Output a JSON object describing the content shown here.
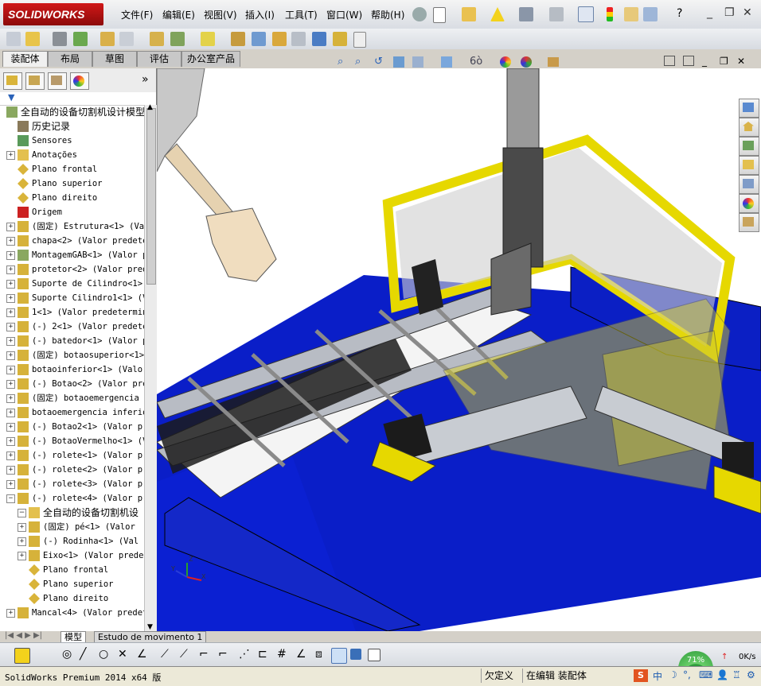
{
  "app": {
    "logo_text": "SOLIDWORKS",
    "brand_color": "#c41212"
  },
  "menu": {
    "items": [
      "文件(F)",
      "编辑(E)",
      "视图(V)",
      "插入(I)",
      "工具(T)",
      "窗口(W)",
      "帮助(H)"
    ]
  },
  "command_tabs": [
    "装配体",
    "布局",
    "草图",
    "评估",
    "办公室产品"
  ],
  "active_command_tab": "装配体",
  "feature_tree": {
    "root": "全自动的设备切割机设计模型",
    "items": [
      {
        "label": "历史记录",
        "icon": "history-icon"
      },
      {
        "label": "Sensores",
        "icon": "sensor-icon"
      },
      {
        "label": "Anotações",
        "icon": "annotation-icon"
      },
      {
        "label": "Plano frontal",
        "icon": "plane-icon"
      },
      {
        "label": "Plano superior",
        "icon": "plane-icon"
      },
      {
        "label": "Plano direito",
        "icon": "plane-icon"
      },
      {
        "label": "Origem",
        "icon": "origin-icon"
      },
      {
        "label": "(固定) Estrutura<1> (Va",
        "icon": "part-icon"
      },
      {
        "label": "chapa<2> (Valor predete",
        "icon": "part-icon"
      },
      {
        "label": "MontagemGAB<1> (Valor p",
        "icon": "assembly-icon"
      },
      {
        "label": "protetor<2> (Valor pred",
        "icon": "part-icon"
      },
      {
        "label": "Suporte de Cilindro<1>",
        "icon": "part-icon"
      },
      {
        "label": "Suporte Cilindro1<1> (V",
        "icon": "part-icon"
      },
      {
        "label": "1<1> (Valor predetermin",
        "icon": "part-icon"
      },
      {
        "label": "(-) 2<1> (Valor predete",
        "icon": "part-icon"
      },
      {
        "label": "(-) batedor<1> (Valor p",
        "icon": "part-icon"
      },
      {
        "label": "(固定) botaosuperior<1>",
        "icon": "part-icon"
      },
      {
        "label": "botaoinferior<1> (Valor",
        "icon": "part-icon"
      },
      {
        "label": "(-) Botao<2> (Valor pre",
        "icon": "part-icon"
      },
      {
        "label": "(固定) botaoemergencia",
        "icon": "part-icon"
      },
      {
        "label": "botaoemergencia inferio",
        "icon": "part-icon"
      },
      {
        "label": "(-) Botao2<1> (Valor pr",
        "icon": "part-icon"
      },
      {
        "label": "(-) BotaoVermelho<1> (V",
        "icon": "part-icon"
      },
      {
        "label": "(-) rolete<1> (Valor pr",
        "icon": "part-icon"
      },
      {
        "label": "(-) rolete<2> (Valor pr",
        "icon": "part-icon"
      },
      {
        "label": "(-) rolete<3> (Valor pr",
        "icon": "part-icon"
      },
      {
        "label": "(-) rolete<4> (Valor pr",
        "icon": "part-icon"
      },
      {
        "label": "全自动的设备切割机设",
        "icon": "folder-icon"
      },
      {
        "label": "(固定) pé<1> (Valor",
        "icon": "part-icon"
      },
      {
        "label": "(-) Rodinha<1> (Val",
        "icon": "part-icon"
      },
      {
        "label": "Eixo<1> (Valor prede",
        "icon": "part-icon"
      },
      {
        "label": "Plano frontal",
        "icon": "plane-icon"
      },
      {
        "label": "Plano superior",
        "icon": "plane-icon"
      },
      {
        "label": "Plano direito",
        "icon": "plane-icon"
      },
      {
        "label": "Mancal<4> (Valor predet",
        "icon": "part-icon"
      }
    ]
  },
  "bottom_tabs": [
    "模型",
    "Estudo de movimento 1"
  ],
  "status": {
    "product": "SolidWorks Premium 2014 x64 版",
    "undefined": "欠定义",
    "editing": "在编辑 装配体",
    "network_rate": "0K/s",
    "progress_percent": "71%"
  },
  "colors": {
    "model_blue": "#0a1ec8",
    "frame_yellow": "#e6d800",
    "viewport_bg": "#ffffff"
  }
}
